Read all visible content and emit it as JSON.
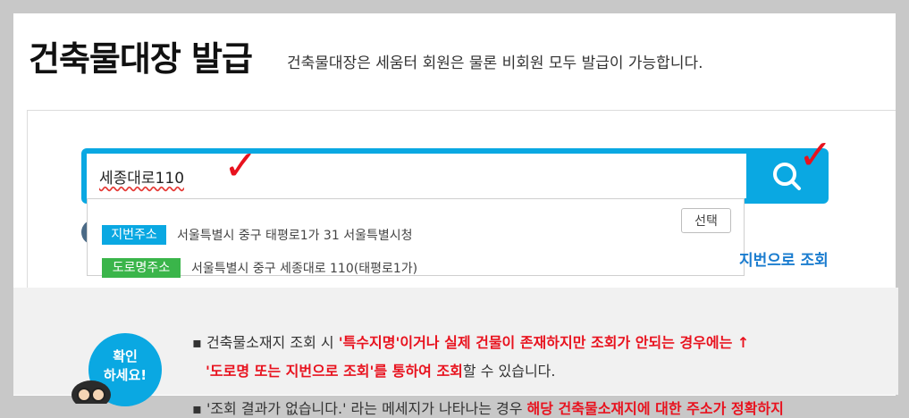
{
  "header": {
    "title": "건축물대장 발급",
    "subtitle": "건축물대장은 세움터 회원은 물론 비회원 모두 발급이 가능합니다."
  },
  "search": {
    "value": "세종대로110",
    "button_icon": "search-icon"
  },
  "suggestions": [
    {
      "badge": "지번주소",
      "address": "서울특별시 중구 태평로1가 31 서울특별시청",
      "badge_color": "#0aa8e2"
    },
    {
      "badge": "도로명주소",
      "address": "서울특별시 중구 세종대로 110(태평로1가)",
      "badge_color": "#3ab54a"
    }
  ],
  "select_label": "선택",
  "jibun_link": "지번으로 조회",
  "info": {
    "line1_prefix": "건축물소재지 조회 시 ",
    "line1_red": "'특수지명'이거나 실제 건물이 존재하지만 조회가 안되는 경우에는 ↑",
    "line2_red": "'도로명 또는 지번으로 조회'를 통하여 조회",
    "line2_suffix": "할 수 있습니다.",
    "line3_prefix": "'조회 결과가 없습니다.' 라는 메세지가 나타나는 경우 ",
    "line3_red": "해당 건축물소재지에 대한 주소가 정확하지",
    "badge_line1": "확인",
    "badge_line2": "하세요!"
  },
  "colors": {
    "accent": "#0aa8e2",
    "road_badge": "#3ab54a",
    "highlight": "#e8121e",
    "link": "#1a7ccf"
  }
}
